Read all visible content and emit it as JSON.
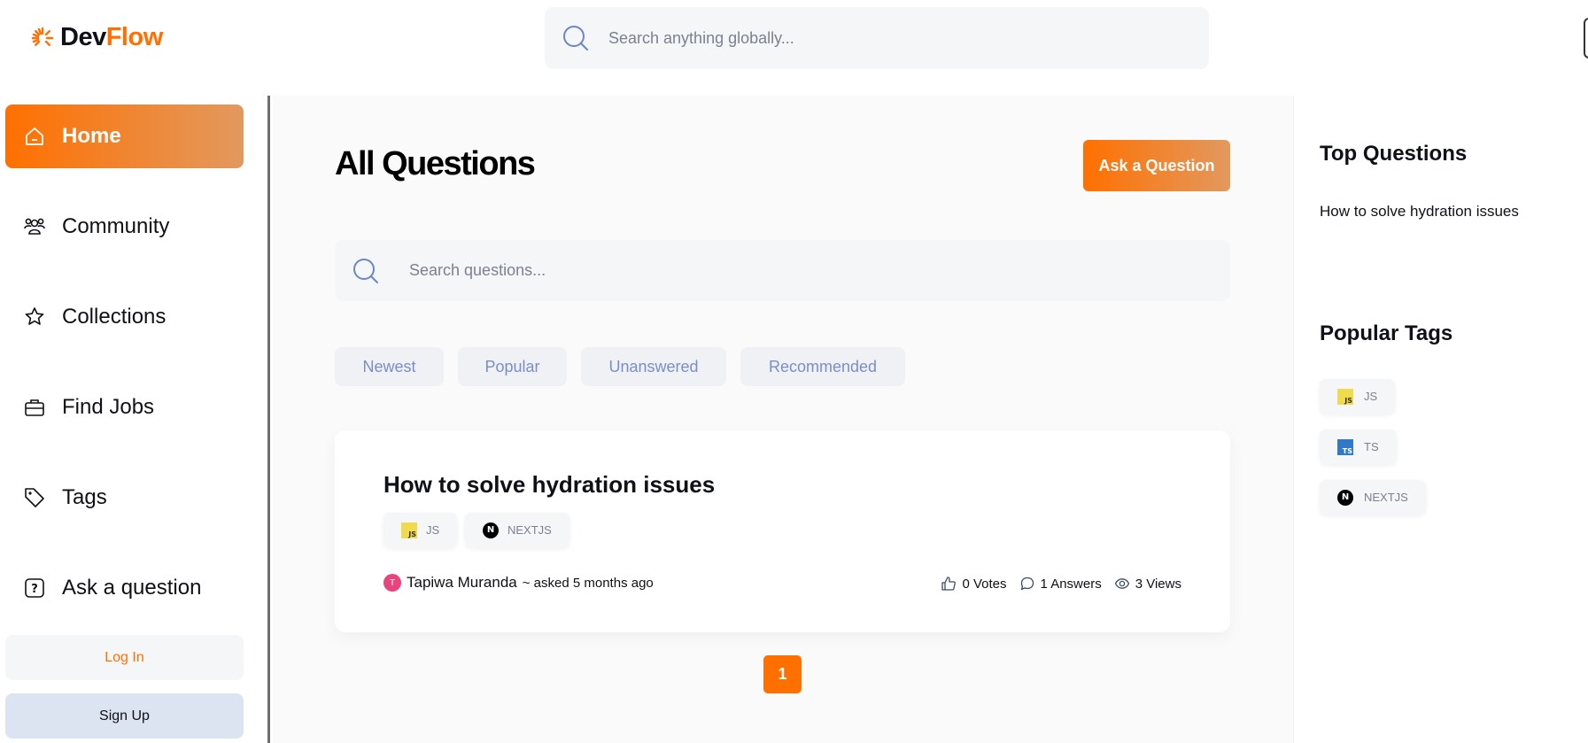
{
  "brand": {
    "name_part1": "Dev",
    "name_part2": "Flow"
  },
  "header": {
    "search_placeholder": "Search anything globally..."
  },
  "sidebar": {
    "items": [
      {
        "label": "Home",
        "icon": "home-icon",
        "active": true
      },
      {
        "label": "Community",
        "icon": "users-icon"
      },
      {
        "label": "Collections",
        "icon": "star-icon"
      },
      {
        "label": "Find Jobs",
        "icon": "briefcase-icon"
      },
      {
        "label": "Tags",
        "icon": "tag-icon"
      },
      {
        "label": "Ask a question",
        "icon": "question-icon"
      }
    ],
    "login_label": "Log In",
    "signup_label": "Sign Up"
  },
  "main": {
    "title": "All Questions",
    "ask_button": "Ask a Question",
    "search_placeholder": "Search questions...",
    "filters": [
      "Newest",
      "Popular",
      "Unanswered",
      "Recommended"
    ],
    "questions": [
      {
        "title": "How to solve hydration issues",
        "tags": [
          "JS",
          "NEXTJS"
        ],
        "author": "Tapiwa Muranda",
        "author_initial": "T",
        "asked": "~ asked 5 months ago",
        "votes": "0 Votes",
        "answers": "1 Answers",
        "views": "3 Views"
      }
    ],
    "current_page": "1"
  },
  "right_sidebar": {
    "top_questions_title": "Top Questions",
    "top_questions": [
      "How to solve hydration issues"
    ],
    "popular_tags_title": "Popular Tags",
    "popular_tags": [
      "JS",
      "TS",
      "NEXTJS"
    ]
  },
  "colors": {
    "accent": "#ff7000",
    "accent_end": "#e2995f",
    "muted_text": "#7b8191",
    "filter_text": "#7b8ec8"
  }
}
